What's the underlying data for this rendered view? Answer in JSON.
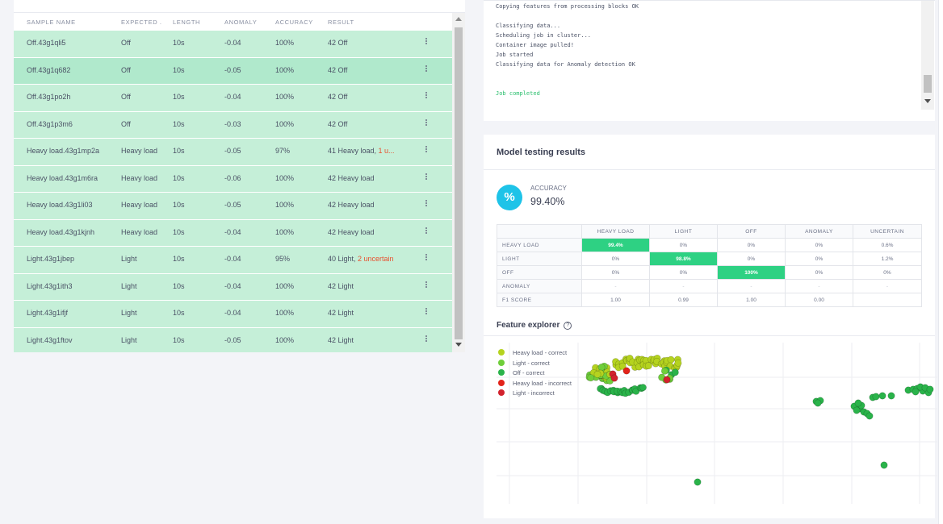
{
  "table": {
    "columns": [
      "SAMPLE NAME",
      "EXPECTED ...",
      "LENGTH",
      "ANOMALY",
      "ACCURACY",
      "RESULT"
    ],
    "rows": [
      {
        "name": "Off.43g1qli5",
        "expected": "Off",
        "length": "10s",
        "anomaly": "-0.04",
        "accuracy": "100%",
        "result": "42 Off",
        "uncertain": ""
      },
      {
        "name": "Off.43g1q682",
        "expected": "Off",
        "length": "10s",
        "anomaly": "-0.05",
        "accuracy": "100%",
        "result": "42 Off",
        "uncertain": ""
      },
      {
        "name": "Off.43g1po2h",
        "expected": "Off",
        "length": "10s",
        "anomaly": "-0.04",
        "accuracy": "100%",
        "result": "42 Off",
        "uncertain": ""
      },
      {
        "name": "Off.43g1p3m6",
        "expected": "Off",
        "length": "10s",
        "anomaly": "-0.03",
        "accuracy": "100%",
        "result": "42 Off",
        "uncertain": ""
      },
      {
        "name": "Heavy load.43g1mp2a",
        "expected": "Heavy load",
        "length": "10s",
        "anomaly": "-0.05",
        "accuracy": "97%",
        "result": "41 Heavy load, ",
        "uncertain": "1 u..."
      },
      {
        "name": "Heavy load.43g1m6ra",
        "expected": "Heavy load",
        "length": "10s",
        "anomaly": "-0.06",
        "accuracy": "100%",
        "result": "42 Heavy load",
        "uncertain": ""
      },
      {
        "name": "Heavy load.43g1li03",
        "expected": "Heavy load",
        "length": "10s",
        "anomaly": "-0.05",
        "accuracy": "100%",
        "result": "42 Heavy load",
        "uncertain": ""
      },
      {
        "name": "Heavy load.43g1kjnh",
        "expected": "Heavy load",
        "length": "10s",
        "anomaly": "-0.04",
        "accuracy": "100%",
        "result": "42 Heavy load",
        "uncertain": ""
      },
      {
        "name": "Light.43g1jbep",
        "expected": "Light",
        "length": "10s",
        "anomaly": "-0.04",
        "accuracy": "95%",
        "result": "40 Light, ",
        "uncertain": "2 uncertain"
      },
      {
        "name": "Light.43g1ith3",
        "expected": "Light",
        "length": "10s",
        "anomaly": "-0.04",
        "accuracy": "100%",
        "result": "42 Light",
        "uncertain": ""
      },
      {
        "name": "Light.43g1ifjf",
        "expected": "Light",
        "length": "10s",
        "anomaly": "-0.04",
        "accuracy": "100%",
        "result": "42 Light",
        "uncertain": ""
      },
      {
        "name": "Light.43g1ftov",
        "expected": "Light",
        "length": "10s",
        "anomaly": "-0.05",
        "accuracy": "100%",
        "result": "42 Light",
        "uncertain": ""
      }
    ]
  },
  "log": {
    "lines": [
      "Copying features from processing blocks OK",
      "",
      "Classifying data...",
      "Scheduling job in cluster...",
      "Container image pulled!",
      "Job started",
      "Classifying data for Anomaly detection OK",
      "",
      "",
      "Job completed"
    ]
  },
  "results": {
    "title": "Model testing results",
    "accuracy_icon": "%",
    "accuracy_label": "ACCURACY",
    "accuracy_value": "99.40%",
    "matrix": {
      "columns": [
        "HEAVY LOAD",
        "LIGHT",
        "OFF",
        "ANOMALY",
        "UNCERTAIN"
      ],
      "rows": [
        {
          "label": "HEAVY LOAD",
          "values": [
            "99.4%",
            "0%",
            "0%",
            "0%",
            "0.6%"
          ]
        },
        {
          "label": "LIGHT",
          "values": [
            "0%",
            "98.8%",
            "0%",
            "0%",
            "1.2%"
          ]
        },
        {
          "label": "OFF",
          "values": [
            "0%",
            "0%",
            "100%",
            "0%",
            "0%"
          ]
        },
        {
          "label": "ANOMALY",
          "values": [
            "-",
            "-",
            "-",
            "-",
            "-"
          ]
        },
        {
          "label": "F1 SCORE",
          "values": [
            "1.00",
            "0.99",
            "1.00",
            "0.00",
            ""
          ]
        }
      ]
    },
    "feature_explorer_title": "Feature explorer",
    "help_icon": "?",
    "legend": [
      {
        "label": "Heavy load - correct",
        "color": "#b5d31f"
      },
      {
        "label": "Light - correct",
        "color": "#6fce3a"
      },
      {
        "label": "Off - correct",
        "color": "#2ab34a"
      },
      {
        "label": "Heavy load - incorrect",
        "color": "#e2231a"
      },
      {
        "label": "Light - incorrect",
        "color": "#d2222d"
      }
    ]
  },
  "colors": {
    "row_bg": "#c5efd8",
    "accent": "#1ec3e8",
    "diag": "#2ed183",
    "uncertain": "#e8502f"
  }
}
